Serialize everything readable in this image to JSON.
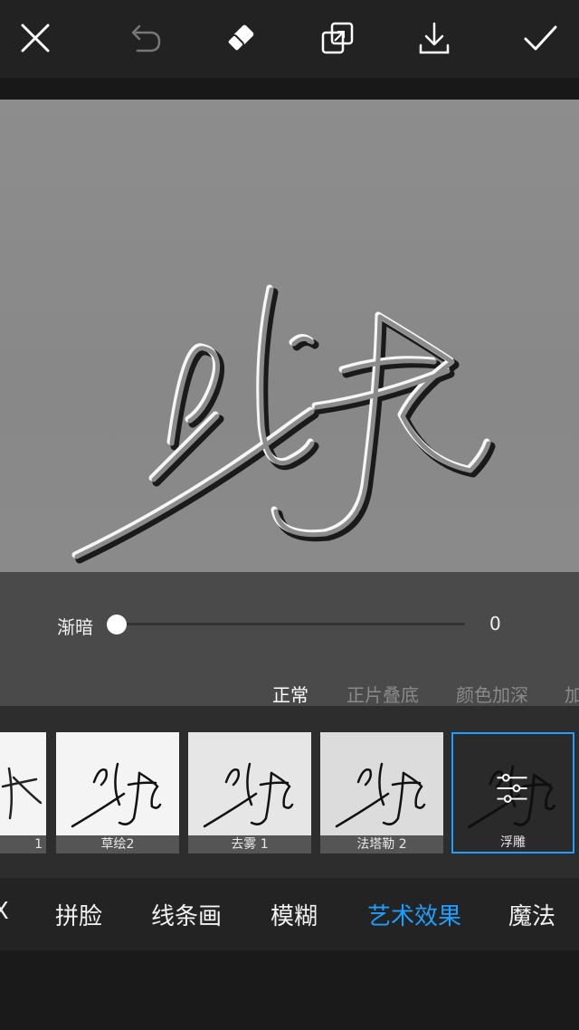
{
  "toolbar": {
    "close_icon": "close-icon",
    "undo_icon": "undo-icon",
    "eraser_icon": "eraser-icon",
    "compare_icon": "compare-icon",
    "download_icon": "download-icon",
    "confirm_icon": "check-icon"
  },
  "canvas": {
    "artwork": "沈技"
  },
  "slider": {
    "label": "渐暗",
    "value": "0",
    "level": 0
  },
  "blend_modes": [
    "正常",
    "正片叠底",
    "颜色加深",
    "加"
  ],
  "blend_active": "正常",
  "effects": [
    {
      "label": "1",
      "selected": false
    },
    {
      "label": "草绘2",
      "selected": false
    },
    {
      "label": "去雾 1",
      "selected": false
    },
    {
      "label": "法塔勒 2",
      "selected": false
    },
    {
      "label": "浮雕",
      "selected": true
    }
  ],
  "categories": [
    "X",
    "拼脸",
    "线条画",
    "模糊",
    "艺术效果",
    "魔法"
  ],
  "category_active": "艺术效果",
  "colors": {
    "accent": "#1e9fff",
    "canvas_gray": "#8a8a8a"
  }
}
